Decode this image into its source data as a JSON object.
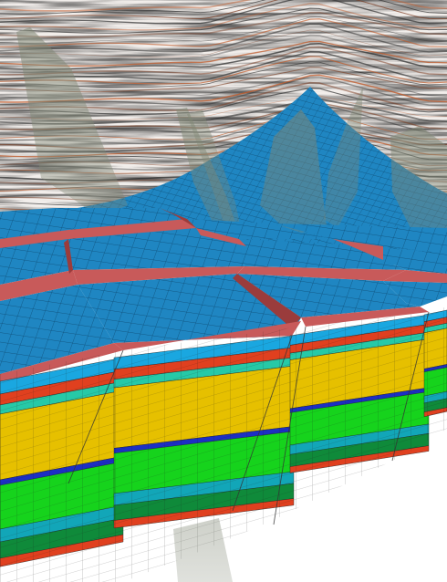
{
  "image": {
    "description_type": "3D geological reservoir grid rendering",
    "has_text": false
  },
  "colors": {
    "background": "#ffffff",
    "seismic_light": "#f4f1ee",
    "seismic_dark": "#2a2a2a",
    "seismic_orange": "#c05a2a",
    "top_surface_blue": "#1f86c2",
    "grid_line": "#0b3f63",
    "fault_red": "#c85a5a",
    "fault_red_dark": "#9a3c3c",
    "fault_plane": "#8f9584",
    "layer_light_blue": "#1aa7e0",
    "layer_red": "#e0401f",
    "layer_teal": "#26c9a7",
    "layer_yellow": "#e6c000",
    "layer_dark_blue": "#1c2fc4",
    "layer_green": "#16d31c",
    "layer_cyan": "#12a6b8",
    "layer_dark_green": "#0f8a3a"
  },
  "layers": [
    {
      "name": "top",
      "color_key": "layer_light_blue"
    },
    {
      "name": "red",
      "color_key": "layer_red"
    },
    {
      "name": "teal",
      "color_key": "layer_teal"
    },
    {
      "name": "yellow",
      "color_key": "layer_yellow"
    },
    {
      "name": "dark-blue",
      "color_key": "layer_dark_blue"
    },
    {
      "name": "green",
      "color_key": "layer_green"
    },
    {
      "name": "cyan",
      "color_key": "layer_cyan"
    },
    {
      "name": "dark-green",
      "color_key": "layer_dark_green"
    },
    {
      "name": "base-red",
      "color_key": "layer_red"
    }
  ]
}
